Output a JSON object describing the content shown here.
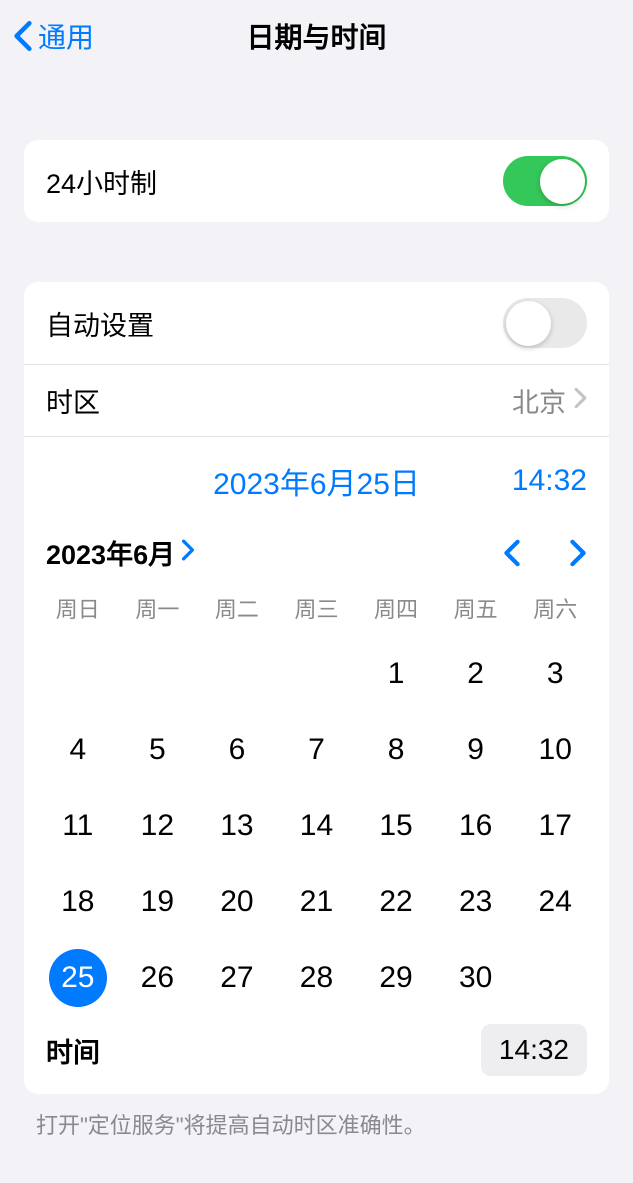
{
  "header": {
    "back_label": "通用",
    "title": "日期与时间"
  },
  "settings": {
    "format_24h_label": "24小时制",
    "auto_set_label": "自动设置",
    "timezone_label": "时区",
    "timezone_value": "北京"
  },
  "date_time": {
    "date_display": "2023年6月25日",
    "time_display": "14:32"
  },
  "calendar": {
    "month_label": "2023年6月",
    "weekdays": [
      "周日",
      "周一",
      "周二",
      "周三",
      "周四",
      "周五",
      "周六"
    ],
    "leading_blanks": 4,
    "days": [
      1,
      2,
      3,
      4,
      5,
      6,
      7,
      8,
      9,
      10,
      11,
      12,
      13,
      14,
      15,
      16,
      17,
      18,
      19,
      20,
      21,
      22,
      23,
      24,
      25,
      26,
      27,
      28,
      29,
      30
    ],
    "selected": 25
  },
  "time_picker": {
    "label": "时间",
    "value": "14:32"
  },
  "footer_hint": "打开\"定位服务\"将提高自动时区准确性。"
}
